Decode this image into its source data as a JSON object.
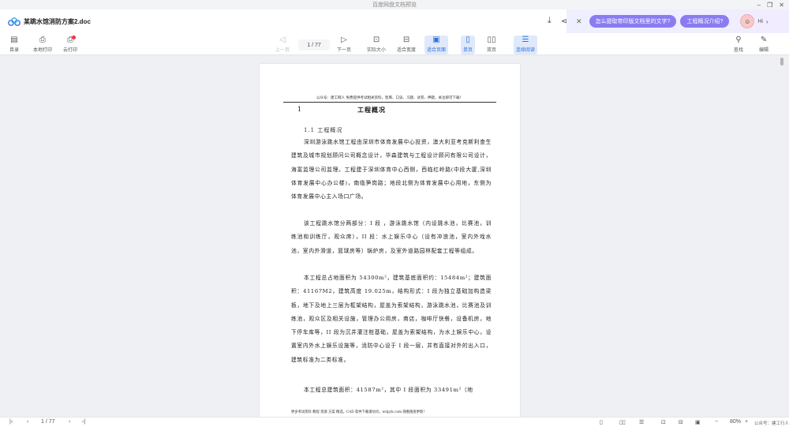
{
  "window": {
    "title": "百度网盘文档预览"
  },
  "header": {
    "doc_title": "某跳水馆消防方案2.doc",
    "ai": {
      "q1": "怎么提取带印版文档里的文字?",
      "q2": "工程概况介绍?",
      "hi": "Hi"
    }
  },
  "toolbar": {
    "catalog": "目录",
    "local_print": "本地打印",
    "cloud_print": "云打印",
    "prev": "上一页",
    "page_current": "1",
    "page_total": "77",
    "page_display": "1 / 77",
    "next": "下一页",
    "actual_size": "实际大小",
    "fit_width": "适合宽度",
    "fit_page": "适合页面",
    "single": "单页",
    "double": "双页",
    "continuous": "连续阅读",
    "search": "查找",
    "edit": "编辑"
  },
  "document": {
    "page_header": "公众号：建工网人 免费提供考试相关资料，智库、口诀、习题、试卷、押题，关注即可下载！",
    "chapter_num": "1",
    "chapter_title": "工程概况",
    "section": "1.1 工程概况",
    "paragraphs": [
      "深圳游泳跳水馆工程由深圳市体育发展中心投资，澳大利亚考克斯利查生建筑及城市规划顾问公司概念设计，华森建筑与工程设计顾问有限公司设计，海富监理公司监理。工程建于深圳体育中心西侧，西临红岭路(中段大厦,深圳体育发展中心办公楼)，南临笋岗路；地段北侧为体育发展中心用地，东侧为体育发展中心主入场口广场。",
      "该工程跳水馆分两部分：I 段 ，游泳跳水馆（内设跳水池，比赛池，训练池和训练厅，观众席），II 段：水上娱乐中心（设有冲浪池，室内外戏水池，室内外滑道，篮球房等）锅炉房，及室外道路园林配套工程等组成。",
      "本工程总占地面积为 54300m²，建筑基底面积约：15484m²；建筑面积：41167M2，建筑高度 19.025m，结构形式：I 段为独立基础加构造梁板，地下及地上三层为框架结构，屋盖为索架结构，游泳跳水池，比赛池及训练池，观众区及相关设施，管理办公用房，商店，咖啡厅快餐，设备机房，地下停车库等，II 段为沉井灌注桩基础，屋盖为索架结构，为水上娱乐中心，设置室内外水上娱乐设施等，消防中心设于 I 段一层，并有直接对外的出入口，建筑标准为二类标准。",
      "本工程总建筑面积：41587m²，其中 I 段面积为 33491m²（地"
    ],
    "page_footer": "更多考试资料 教程 资源 方案 精选，CAD 软件下载请访问，wdpyk.com 随看随查更新！"
  },
  "statusbar": {
    "page_current": "1",
    "page_total": "77",
    "page_display": "1 / 77",
    "zoom": "80%",
    "watermark": "公众号：建工行人"
  }
}
